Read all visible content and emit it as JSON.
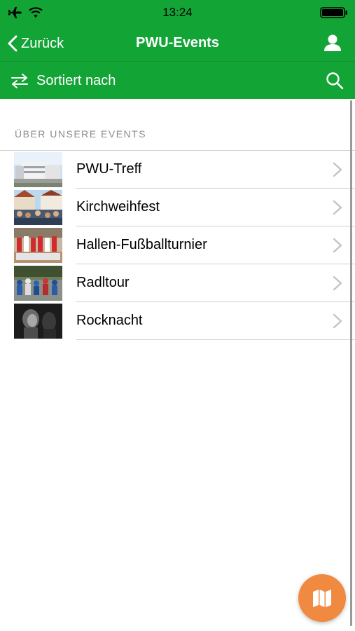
{
  "status": {
    "time": "13:24"
  },
  "nav": {
    "back_label": "Zurück",
    "title": "PWU-Events"
  },
  "toolbar": {
    "sort_label": "Sortiert nach"
  },
  "section": {
    "header": "ÜBER UNSERE EVENTS"
  },
  "events": [
    {
      "label": "PWU-Treff"
    },
    {
      "label": "Kirchweihfest"
    },
    {
      "label": "Hallen-Fußballturnier"
    },
    {
      "label": "Radltour"
    },
    {
      "label": "Rocknacht"
    }
  ],
  "colors": {
    "primary": "#13a436",
    "fab": "#f08a40"
  },
  "icons": {
    "back": "chevron-left-icon",
    "profile": "person-icon",
    "sort": "swap-arrows-icon",
    "search": "search-icon",
    "row": "chevron-right-icon",
    "fab": "map-icon"
  }
}
